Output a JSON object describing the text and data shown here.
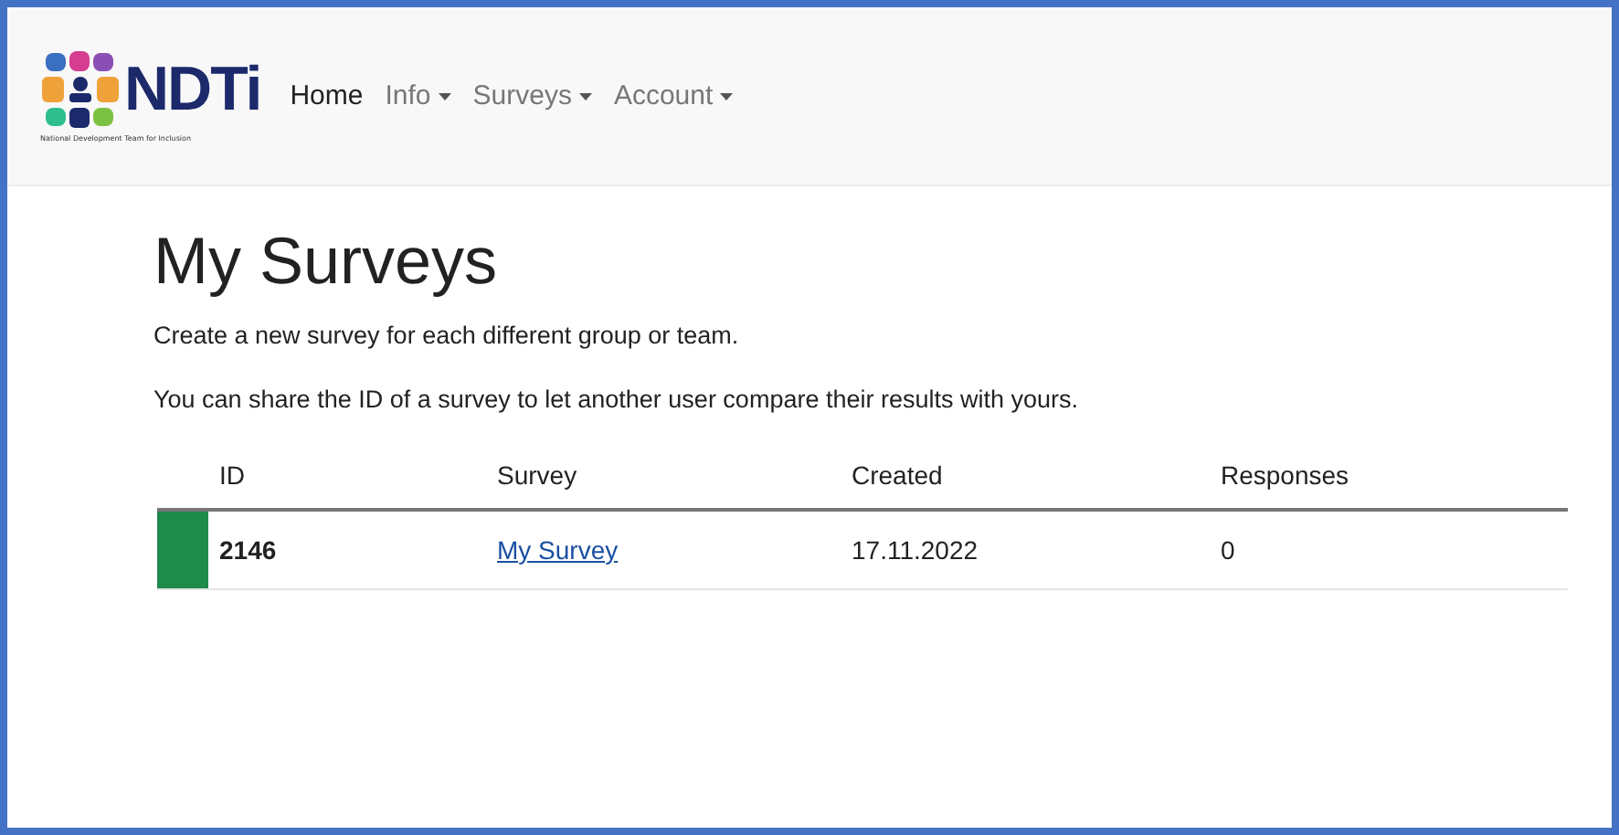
{
  "brand": {
    "name": "NDTi",
    "tagline": "National Development Team for Inclusion"
  },
  "nav": [
    {
      "label": "Home",
      "dropdown": false,
      "selected": true
    },
    {
      "label": "Info",
      "dropdown": true,
      "selected": false
    },
    {
      "label": "Surveys",
      "dropdown": true,
      "selected": false
    },
    {
      "label": "Account",
      "dropdown": true,
      "selected": false
    }
  ],
  "heading": "My Surveys",
  "intro": [
    "Create a new survey for each different group or team.",
    "You can share the ID of a survey to let another user compare their results with yours."
  ],
  "table": {
    "columns": [
      "ID",
      "Survey",
      "Created",
      "Responses"
    ],
    "rows": [
      {
        "color": "#1e8a4c",
        "id": "2146",
        "survey": "My Survey",
        "created": "17.11.2022",
        "responses": "0"
      }
    ]
  }
}
